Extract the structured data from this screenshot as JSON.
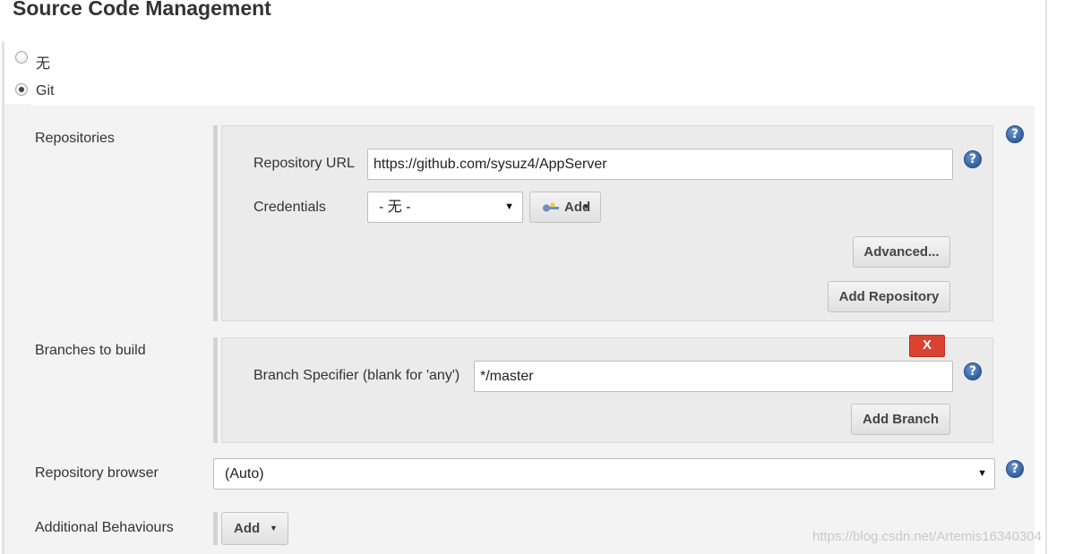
{
  "page_title": "Source Code Management",
  "scm_options": [
    {
      "label": "无",
      "selected": false
    },
    {
      "label": "Git",
      "selected": true
    }
  ],
  "repositories": {
    "label": "Repositories",
    "url_label": "Repository URL",
    "url_value": "https://github.com/sysuz4/AppServer",
    "credentials_label": "Credentials",
    "credentials_value": "- 无 -",
    "add_credentials_label": "Add",
    "advanced_label": "Advanced...",
    "add_repository_label": "Add Repository"
  },
  "branches": {
    "label": "Branches to build",
    "delete_label": "X",
    "specifier_label": "Branch Specifier (blank for 'any')",
    "specifier_value": "*/master",
    "add_branch_label": "Add Branch"
  },
  "repository_browser": {
    "label": "Repository browser",
    "value": "(Auto)"
  },
  "additional_behaviours": {
    "label": "Additional Behaviours",
    "add_label": "Add"
  },
  "help_icon_text": "?",
  "watermark": "https://blog.csdn.net/Artemis16340304",
  "colors": {
    "help_blue": "#2d5c9f",
    "delete_red": "#d9432f",
    "panel_gray": "#f3f3f3"
  }
}
